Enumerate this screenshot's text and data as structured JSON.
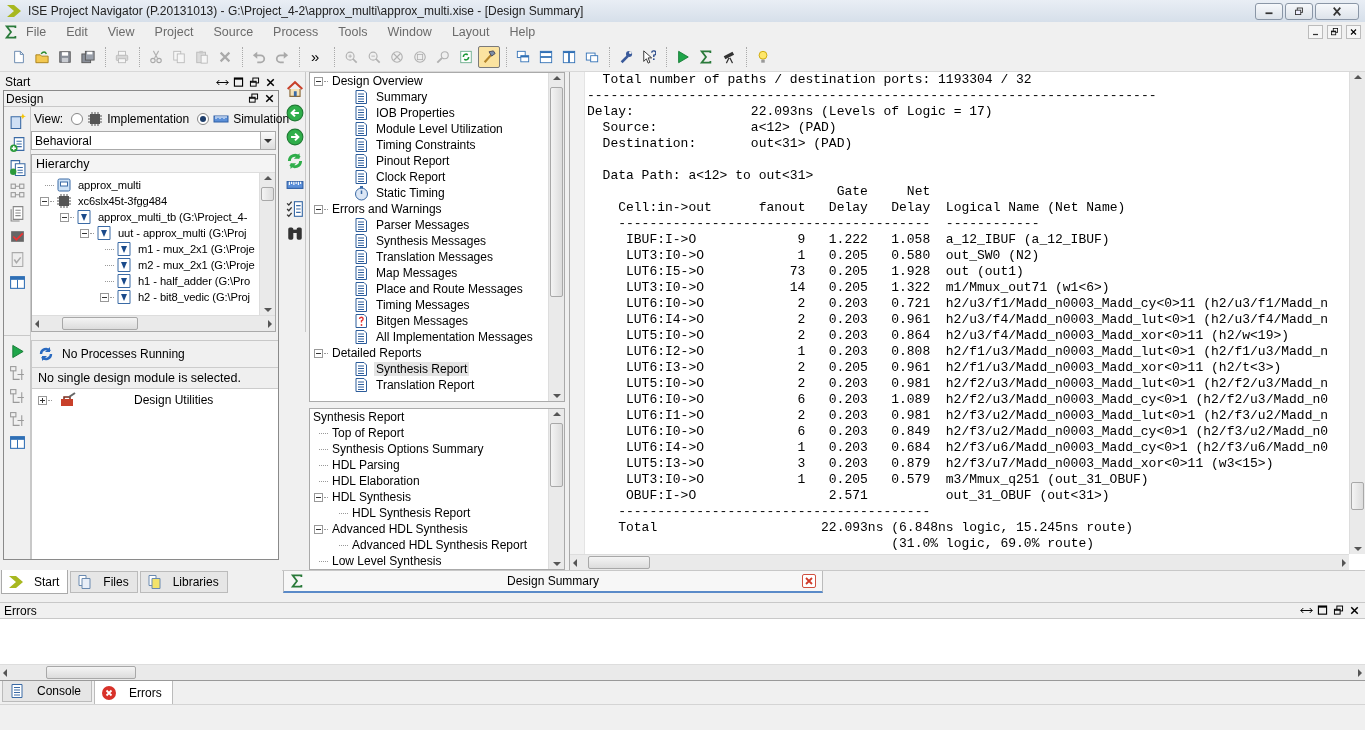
{
  "window": {
    "title": "ISE Project Navigator (P.20131013) - G:\\Project_4-2\\approx_multi\\approx_multi.xise - [Design Summary]"
  },
  "menu": [
    "File",
    "Edit",
    "View",
    "Project",
    "Source",
    "Process",
    "Tools",
    "Window",
    "Layout",
    "Help"
  ],
  "toolbar": [
    {
      "kind": "new",
      "disabled": false,
      "pressed": false
    },
    {
      "kind": "open",
      "disabled": false,
      "pressed": false
    },
    {
      "kind": "save",
      "disabled": false,
      "pressed": false
    },
    {
      "kind": "save-all",
      "disabled": false,
      "pressed": false
    },
    {
      "kind": "separator"
    },
    {
      "kind": "print",
      "disabled": true,
      "pressed": false
    },
    {
      "kind": "separator"
    },
    {
      "kind": "cut",
      "disabled": true,
      "pressed": false
    },
    {
      "kind": "copy",
      "disabled": true,
      "pressed": false
    },
    {
      "kind": "paste",
      "disabled": true,
      "pressed": false
    },
    {
      "kind": "delete",
      "disabled": true,
      "pressed": false
    },
    {
      "kind": "separator"
    },
    {
      "kind": "undo",
      "disabled": true,
      "pressed": false
    },
    {
      "kind": "redo",
      "disabled": true,
      "pressed": false
    },
    {
      "kind": "separator"
    },
    {
      "kind": "overflow",
      "label": "»"
    },
    {
      "kind": "separator"
    },
    {
      "kind": "zoom-in",
      "disabled": true,
      "pressed": false
    },
    {
      "kind": "zoom-out",
      "disabled": true,
      "pressed": false
    },
    {
      "kind": "zoom-fit",
      "disabled": true,
      "pressed": false
    },
    {
      "kind": "zoom-full",
      "disabled": true,
      "pressed": false
    },
    {
      "kind": "zoom-select",
      "disabled": true,
      "pressed": false
    },
    {
      "kind": "refresh",
      "disabled": false,
      "pressed": false
    },
    {
      "kind": "hammer",
      "disabled": false,
      "pressed": true
    },
    {
      "kind": "separator"
    },
    {
      "kind": "cascade",
      "disabled": false,
      "pressed": false
    },
    {
      "kind": "tile-h",
      "disabled": false,
      "pressed": false
    },
    {
      "kind": "tile-v",
      "disabled": false,
      "pressed": false
    },
    {
      "kind": "windows",
      "disabled": false,
      "pressed": false
    },
    {
      "kind": "separator"
    },
    {
      "kind": "wrench",
      "disabled": false,
      "pressed": false
    },
    {
      "kind": "whats-this",
      "disabled": false,
      "pressed": false
    },
    {
      "kind": "separator"
    },
    {
      "kind": "run",
      "disabled": false,
      "pressed": false
    },
    {
      "kind": "sigma",
      "disabled": false,
      "pressed": false
    },
    {
      "kind": "telescope",
      "disabled": false,
      "pressed": false
    },
    {
      "kind": "separator"
    },
    {
      "kind": "bulb",
      "disabled": false,
      "pressed": false
    }
  ],
  "start_panel": {
    "title": "Start"
  },
  "design_panel": {
    "title": "Design",
    "view_label": "View:",
    "view_options": [
      {
        "label": "Implementation",
        "selected": false
      },
      {
        "label": "Simulation",
        "selected": true
      }
    ],
    "dropdown": {
      "value": "Behavioral"
    },
    "hierarchy_header": "Hierarchy",
    "hierarchy": [
      {
        "label": "approx_multi",
        "kind": "project"
      },
      {
        "label": "xc6slx45t-3fgg484",
        "kind": "chip",
        "expanded": true,
        "children": [
          {
            "label": "approx_multi_tb (G:\\Project_4-",
            "kind": "verilog",
            "expanded": true,
            "children": [
              {
                "label": "uut - approx_multi (G:\\Proj",
                "kind": "verilog",
                "expanded": true,
                "children": [
                  {
                    "label": "m1 - mux_2x1 (G:\\Proje",
                    "kind": "verilog"
                  },
                  {
                    "label": "m2 - mux_2x1 (G:\\Proje",
                    "kind": "verilog"
                  },
                  {
                    "label": "h1 - half_adder (G:\\Pro",
                    "kind": "verilog"
                  },
                  {
                    "label": "h2 - bit8_vedic (G:\\Proj",
                    "kind": "verilog",
                    "expanded": true
                  }
                ]
              }
            ]
          }
        ]
      }
    ]
  },
  "processes": {
    "status": "No Processes Running",
    "message": "No single design module is selected.",
    "items": [
      {
        "label": "Design Utilities",
        "kind": "toolbox",
        "expanded": false
      }
    ]
  },
  "left_tabs": [
    {
      "label": "Start",
      "kind": "start",
      "selected": true
    },
    {
      "label": "Files",
      "kind": "files",
      "selected": false
    },
    {
      "label": "Libraries",
      "kind": "libraries",
      "selected": false
    }
  ],
  "summary_tree": [
    {
      "label": "Design Overview",
      "selected": false,
      "expanded": true,
      "children": [
        {
          "label": "Summary",
          "kind": "doc",
          "selected": false
        },
        {
          "label": "IOB Properties",
          "kind": "doc",
          "selected": false
        },
        {
          "label": "Module Level Utilization",
          "kind": "doc",
          "selected": false
        },
        {
          "label": "Timing Constraints",
          "kind": "doc",
          "selected": false
        },
        {
          "label": "Pinout Report",
          "kind": "doc",
          "selected": false
        },
        {
          "label": "Clock Report",
          "kind": "doc",
          "selected": false
        },
        {
          "label": "Static Timing",
          "kind": "stopwatch",
          "selected": false
        }
      ]
    },
    {
      "label": "Errors and Warnings",
      "selected": false,
      "expanded": true,
      "children": [
        {
          "label": "Parser Messages",
          "kind": "doc",
          "selected": false
        },
        {
          "label": "Synthesis Messages",
          "kind": "doc",
          "selected": false
        },
        {
          "label": "Translation Messages",
          "kind": "doc",
          "selected": false
        },
        {
          "label": "Map Messages",
          "kind": "doc",
          "selected": false
        },
        {
          "label": "Place and Route Messages",
          "kind": "doc",
          "selected": false
        },
        {
          "label": "Timing Messages",
          "kind": "doc",
          "selected": false
        },
        {
          "label": "Bitgen Messages",
          "kind": "doc-question",
          "selected": false
        },
        {
          "label": "All Implementation Messages",
          "kind": "doc",
          "selected": false
        }
      ]
    },
    {
      "label": "Detailed Reports",
      "selected": false,
      "expanded": true,
      "children": [
        {
          "label": "Synthesis Report",
          "kind": "doc",
          "selected": true
        },
        {
          "label": "Translation Report",
          "kind": "doc",
          "selected": false
        }
      ]
    }
  ],
  "report_outline": {
    "title": "Synthesis Report",
    "items": [
      {
        "label": "Top of Report"
      },
      {
        "label": "Synthesis Options Summary"
      },
      {
        "label": "HDL Parsing"
      },
      {
        "label": "HDL Elaboration"
      },
      {
        "label": "HDL Synthesis",
        "expanded": true,
        "children": [
          {
            "label": "HDL Synthesis Report"
          }
        ]
      },
      {
        "label": "Advanced HDL Synthesis",
        "expanded": true,
        "children": [
          {
            "label": "Advanced HDL Synthesis Report"
          }
        ]
      },
      {
        "label": "Low Level Synthesis"
      }
    ]
  },
  "report": {
    "summary_lines": [
      "  Total number of paths / destination ports: 1193304 / 32",
      "-------------------------------------------------------------------------",
      "Delay:               22.093ns (Levels of Logic = 17)",
      "  Source:            a<12> (PAD)",
      "  Destination:       out<31> (PAD)"
    ],
    "data_path": "  Data Path: a<12> to out<31>",
    "header_lines": [
      "                                Gate     Net",
      "    Cell:in->out      fanout   Delay   Delay  Logical Name (Net Name)",
      "    ----------------------------------------  ------------"
    ],
    "rows": [
      {
        "cell": "IBUF:I->O",
        "fanout": "9",
        "gate_delay": "1.222",
        "net_delay": "1.058",
        "name": "a_12_IBUF (a_12_IBUF)"
      },
      {
        "cell": "LUT3:I0->O",
        "fanout": "1",
        "gate_delay": "0.205",
        "net_delay": "0.580",
        "name": "out_SW0 (N2)"
      },
      {
        "cell": "LUT6:I5->O",
        "fanout": "73",
        "gate_delay": "0.205",
        "net_delay": "1.928",
        "name": "out (out1)"
      },
      {
        "cell": "LUT3:I0->O",
        "fanout": "14",
        "gate_delay": "0.205",
        "net_delay": "1.322",
        "name": "m1/Mmux_out71 (w1<6>)"
      },
      {
        "cell": "LUT6:I0->O",
        "fanout": "2",
        "gate_delay": "0.203",
        "net_delay": "0.721",
        "name": "h2/u3/f1/Madd_n0003_Madd_cy<0>11 (h2/u3/f1/Madd_n"
      },
      {
        "cell": "LUT6:I4->O",
        "fanout": "2",
        "gate_delay": "0.203",
        "net_delay": "0.961",
        "name": "h2/u3/f4/Madd_n0003_Madd_lut<0>1 (h2/u3/f4/Madd_n"
      },
      {
        "cell": "LUT5:I0->O",
        "fanout": "2",
        "gate_delay": "0.203",
        "net_delay": "0.864",
        "name": "h2/u3/f4/Madd_n0003_Madd_xor<0>11 (h2/w<19>)"
      },
      {
        "cell": "LUT6:I2->O",
        "fanout": "1",
        "gate_delay": "0.203",
        "net_delay": "0.808",
        "name": "h2/f1/u3/Madd_n0003_Madd_lut<0>1 (h2/f1/u3/Madd_n"
      },
      {
        "cell": "LUT6:I3->O",
        "fanout": "2",
        "gate_delay": "0.205",
        "net_delay": "0.961",
        "name": "h2/f1/u3/Madd_n0003_Madd_xor<0>11 (h2/t<3>)"
      },
      {
        "cell": "LUT5:I0->O",
        "fanout": "2",
        "gate_delay": "0.203",
        "net_delay": "0.981",
        "name": "h2/f2/u3/Madd_n0003_Madd_lut<0>1 (h2/f2/u3/Madd_n"
      },
      {
        "cell": "LUT6:I0->O",
        "fanout": "6",
        "gate_delay": "0.203",
        "net_delay": "1.089",
        "name": "h2/f2/u3/Madd_n0003_Madd_cy<0>1 (h2/f2/u3/Madd_n0"
      },
      {
        "cell": "LUT6:I1->O",
        "fanout": "2",
        "gate_delay": "0.203",
        "net_delay": "0.981",
        "name": "h2/f3/u2/Madd_n0003_Madd_lut<0>1 (h2/f3/u2/Madd_n"
      },
      {
        "cell": "LUT6:I0->O",
        "fanout": "6",
        "gate_delay": "0.203",
        "net_delay": "0.849",
        "name": "h2/f3/u2/Madd_n0003_Madd_cy<0>1 (h2/f3/u2/Madd_n0"
      },
      {
        "cell": "LUT6:I4->O",
        "fanout": "1",
        "gate_delay": "0.203",
        "net_delay": "0.684",
        "name": "h2/f3/u6/Madd_n0003_Madd_cy<0>1 (h2/f3/u6/Madd_n0"
      },
      {
        "cell": "LUT5:I3->O",
        "fanout": "3",
        "gate_delay": "0.203",
        "net_delay": "0.879",
        "name": "h2/f3/u7/Madd_n0003_Madd_xor<0>11 (w3<15>)"
      },
      {
        "cell": "LUT3:I0->O",
        "fanout": "1",
        "gate_delay": "0.205",
        "net_delay": "0.579",
        "name": "m3/Mmux_q251 (out_31_OBUF)"
      },
      {
        "cell": "OBUF:I->O",
        "gate_delay": "2.571",
        "name": "out_31_OBUF (out<31>)"
      }
    ],
    "footer_lines": [
      "    ----------------------------------------",
      "    Total                     22.093ns (6.848ns logic, 15.245ns route)",
      "                                       (31.0% logic, 69.0% route)"
    ]
  },
  "doc_tabs": [
    {
      "label": "Design Summary",
      "selected": true
    }
  ],
  "console_panel": {
    "title": "Errors"
  },
  "bottom_tabs": [
    {
      "label": "Console",
      "kind": "console",
      "selected": false
    },
    {
      "label": "Errors",
      "kind": "errors",
      "selected": true
    }
  ]
}
